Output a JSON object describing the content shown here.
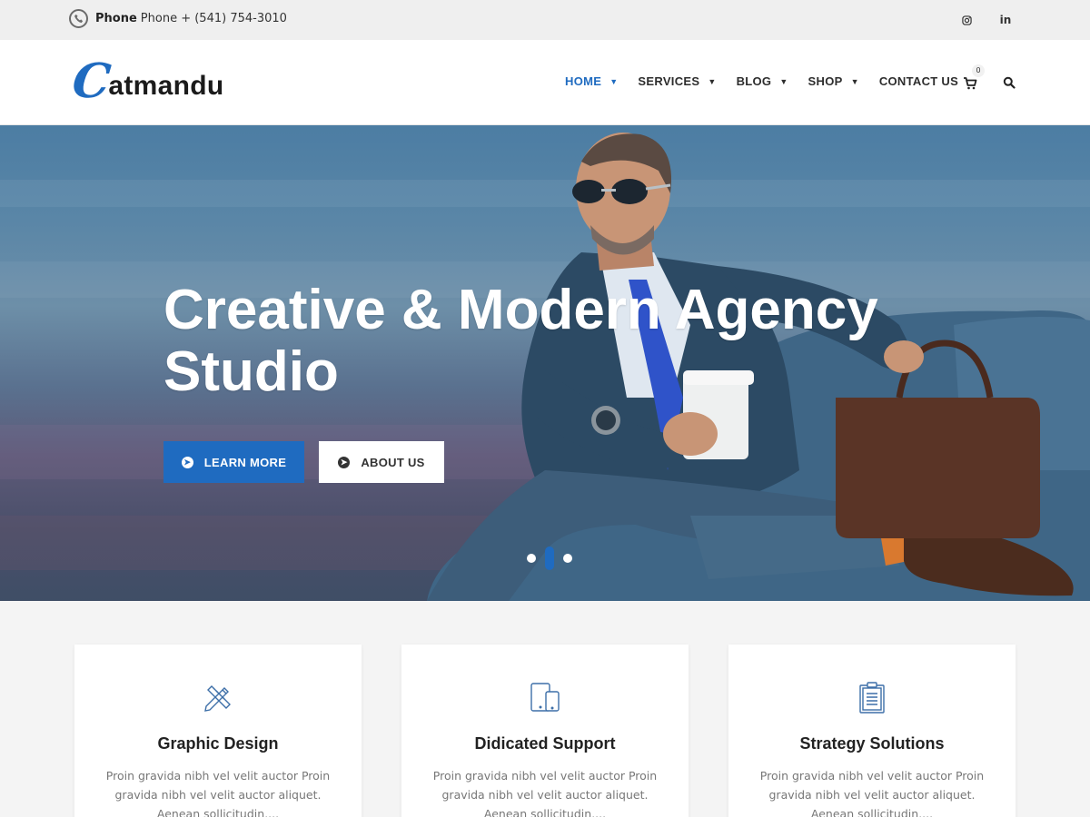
{
  "topbar": {
    "phone_label": "Phone",
    "phone_text": "Phone + (541) 754-3010",
    "social": [
      {
        "icon": "instagram-icon"
      },
      {
        "icon": "linkedin-icon",
        "glyph": "in"
      }
    ]
  },
  "header": {
    "logo": {
      "initial": "C",
      "rest": "atmandu"
    },
    "nav": [
      {
        "label": "HOME",
        "has_dropdown": true,
        "active": true
      },
      {
        "label": "SERVICES",
        "has_dropdown": true
      },
      {
        "label": "BLOG",
        "has_dropdown": true
      },
      {
        "label": "SHOP",
        "has_dropdown": true
      },
      {
        "label": "CONTACT US",
        "has_dropdown": false
      }
    ],
    "cart_count": "0",
    "accent_color": "#1f6bc0"
  },
  "hero": {
    "title": "Creative & Modern Agency Studio",
    "buttons": {
      "learn_more": "LEARN MORE",
      "about_us": "ABOUT US"
    },
    "slides_total": 3,
    "active_slide": 2
  },
  "features": [
    {
      "icon": "pencil-ruler-icon",
      "title": "Graphic Design",
      "text": "Proin gravida nibh vel velit auctor Proin gravida nibh vel velit auctor aliquet. Aenean sollicitudin,..."
    },
    {
      "icon": "devices-icon",
      "title": "Didicated Support",
      "text": "Proin gravida nibh vel velit auctor Proin gravida nibh vel velit auctor aliquet. Aenean sollicitudin,..."
    },
    {
      "icon": "clipboard-icon",
      "title": "Strategy Solutions",
      "text": "Proin gravida nibh vel velit auctor Proin gravida nibh vel velit auctor aliquet. Aenean sollicitudin,..."
    }
  ]
}
